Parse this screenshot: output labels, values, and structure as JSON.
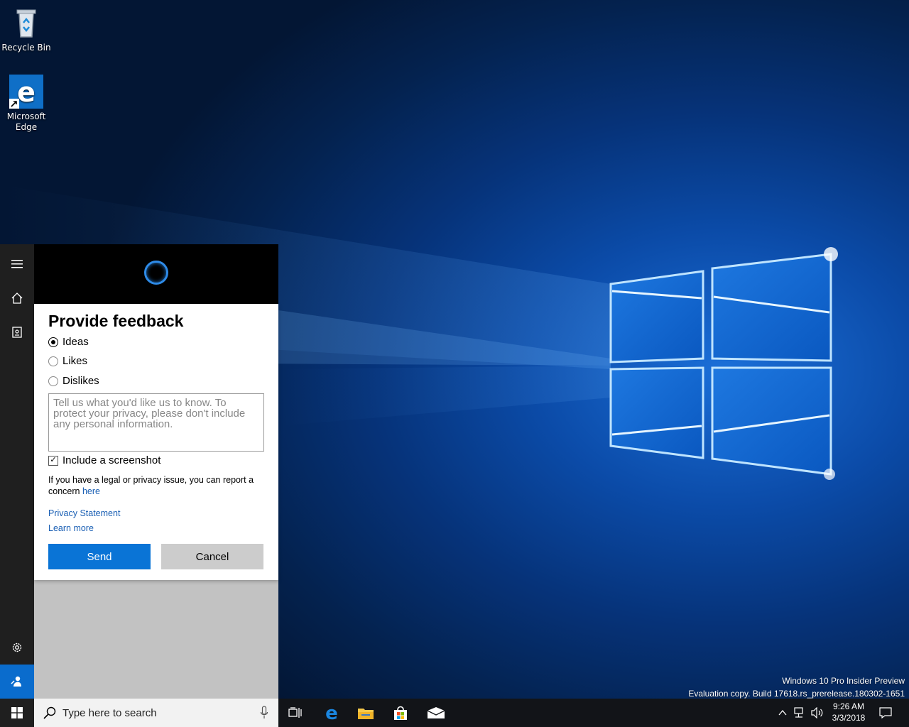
{
  "desktop": {
    "icons": [
      {
        "name": "recycle-bin",
        "label": "Recycle Bin"
      },
      {
        "name": "microsoft-edge",
        "label": "Microsoft Edge"
      }
    ],
    "watermark": {
      "line1": "Windows 10 Pro Insider Preview",
      "line2": "Evaluation copy. Build 17618.rs_prerelease.180302-1651"
    }
  },
  "cortana": {
    "rail_icons": [
      "menu-icon",
      "home-icon",
      "notebook-icon",
      "settings-icon",
      "feedback-icon"
    ],
    "feedback": {
      "title": "Provide feedback",
      "options": [
        {
          "label": "Ideas",
          "checked": true
        },
        {
          "label": "Likes",
          "checked": false
        },
        {
          "label": "Dislikes",
          "checked": false
        }
      ],
      "textarea_placeholder": "Tell us what you'd like us to know. To protect your privacy, please don't include any personal information.",
      "screenshot_label": "Include a screenshot",
      "screenshot_checked": true,
      "legal_text": "If you have a legal or privacy issue, you can report a concern",
      "legal_link": "here",
      "privacy_link": "Privacy Statement",
      "learn_more_link": "Learn more",
      "send_label": "Send",
      "cancel_label": "Cancel"
    }
  },
  "taskbar": {
    "search_placeholder": "Type here to search",
    "apps": [
      "task-view-icon",
      "edge-icon",
      "file-explorer-icon",
      "store-icon",
      "mail-icon"
    ],
    "clock": {
      "time": "9:26 AM",
      "date": "3/3/2018"
    },
    "colors": {
      "accent": "#0a74d6",
      "taskbar": "#121418",
      "rail": "#1f1f1f"
    }
  }
}
